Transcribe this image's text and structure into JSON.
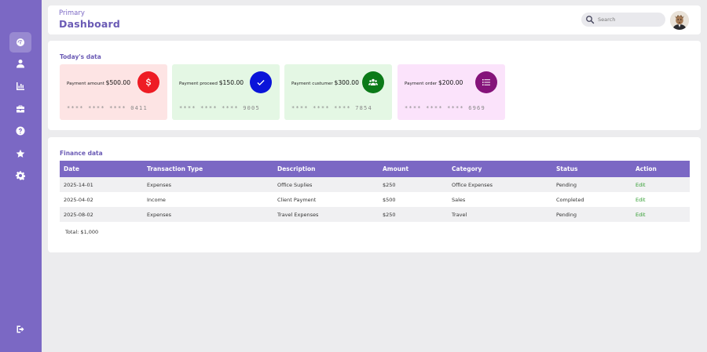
{
  "header": {
    "breadcrumb": "Primary",
    "title": "Dashboard",
    "search_placeholder": "Search"
  },
  "sidebar": {
    "items": [
      {
        "icon": "dashboard-icon",
        "active": true
      },
      {
        "icon": "user-icon",
        "active": false
      },
      {
        "icon": "chart-icon",
        "active": false
      },
      {
        "icon": "briefcase-icon",
        "active": false
      },
      {
        "icon": "help-icon",
        "active": false
      },
      {
        "icon": "star-icon",
        "active": false
      },
      {
        "icon": "settings-icon",
        "active": false
      }
    ],
    "logout_icon": "logout-icon"
  },
  "today": {
    "title": "Today's data",
    "cards": [
      {
        "label": "Payment amount",
        "value": "$500.00",
        "masked": "**** **** **** 0411",
        "icon": "dollar-icon",
        "bg": "#fde4e4",
        "icon_bg": "#ee1c24"
      },
      {
        "label": "Payment proceed",
        "value": "$150.00",
        "masked": "**** **** **** 9005",
        "icon": "check-icon",
        "bg": "#e4f7e4",
        "icon_bg": "#0a14d9"
      },
      {
        "label": "Payment custumer",
        "value": "$300.00",
        "masked": "**** **** **** 7854",
        "icon": "users-icon",
        "bg": "#e4f7e4",
        "icon_bg": "#0b7a18"
      },
      {
        "label": "Payment order",
        "value": "$200.00",
        "masked": "**** **** **** 6969",
        "icon": "list-icon",
        "bg": "#fbe3fb",
        "icon_bg": "#85137a"
      }
    ]
  },
  "finance": {
    "title": "Finance data",
    "columns": [
      "Date",
      "Transaction Type",
      "Description",
      "Amount",
      "Category",
      "Status",
      "Action"
    ],
    "rows": [
      [
        "2025-14-01",
        "Expenses",
        "Office Suplies",
        "$250",
        "Office Expenses",
        "Pending",
        "Edit"
      ],
      [
        "2025-04-02",
        "Income",
        "Client Payment",
        "$500",
        "Sales",
        "Completed",
        "Edit"
      ],
      [
        "2025-08-02",
        "Expenses",
        "Travel Expenses",
        "$250",
        "Travel",
        "Pending",
        "Edit"
      ]
    ],
    "total": "Total: $1,000"
  },
  "colors": {
    "accent": "#7b68c4",
    "edit_link": "#2f9c2f"
  }
}
